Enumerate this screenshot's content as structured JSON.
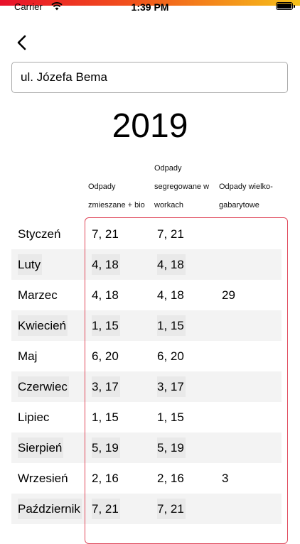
{
  "status_bar": {
    "carrier": "Carrier",
    "time": "1:39 PM",
    "icons": [
      "wifi-icon",
      "battery-icon"
    ]
  },
  "header": {
    "back_icon": "chevron-left-icon",
    "address": "ul. Józefa Bema",
    "year": "2019"
  },
  "colors": {
    "gradient": [
      "#e8102a",
      "#f2541c",
      "#f6c21a"
    ],
    "highlight_border": "#e0485a",
    "row_alt": "#f3f3f3"
  },
  "columns": {
    "mixed": "Odpady zmieszane + bio",
    "segregated": "Odpady segregowane w workach",
    "bulky": "Odpady wielko-gabarytowe"
  },
  "rows": [
    {
      "month": "Styczeń",
      "mixed": "7, 21",
      "segregated": "7, 21",
      "bulky": ""
    },
    {
      "month": "Luty",
      "mixed": "4, 18",
      "segregated": "4, 18",
      "bulky": ""
    },
    {
      "month": "Marzec",
      "mixed": "4, 18",
      "segregated": "4, 18",
      "bulky": "29"
    },
    {
      "month": "Kwiecień",
      "mixed": "1, 15",
      "segregated": "1, 15",
      "bulky": ""
    },
    {
      "month": "Maj",
      "mixed": "6, 20",
      "segregated": "6, 20",
      "bulky": ""
    },
    {
      "month": "Czerwiec",
      "mixed": "3, 17",
      "segregated": "3, 17",
      "bulky": ""
    },
    {
      "month": "Lipiec",
      "mixed": "1, 15",
      "segregated": "1, 15",
      "bulky": ""
    },
    {
      "month": "Sierpień",
      "mixed": "5, 19",
      "segregated": "5, 19",
      "bulky": ""
    },
    {
      "month": "Wrzesień",
      "mixed": "2, 16",
      "segregated": "2, 16",
      "bulky": "3"
    },
    {
      "month": "Październik",
      "mixed": "7, 21",
      "segregated": "7, 21",
      "bulky": ""
    }
  ]
}
